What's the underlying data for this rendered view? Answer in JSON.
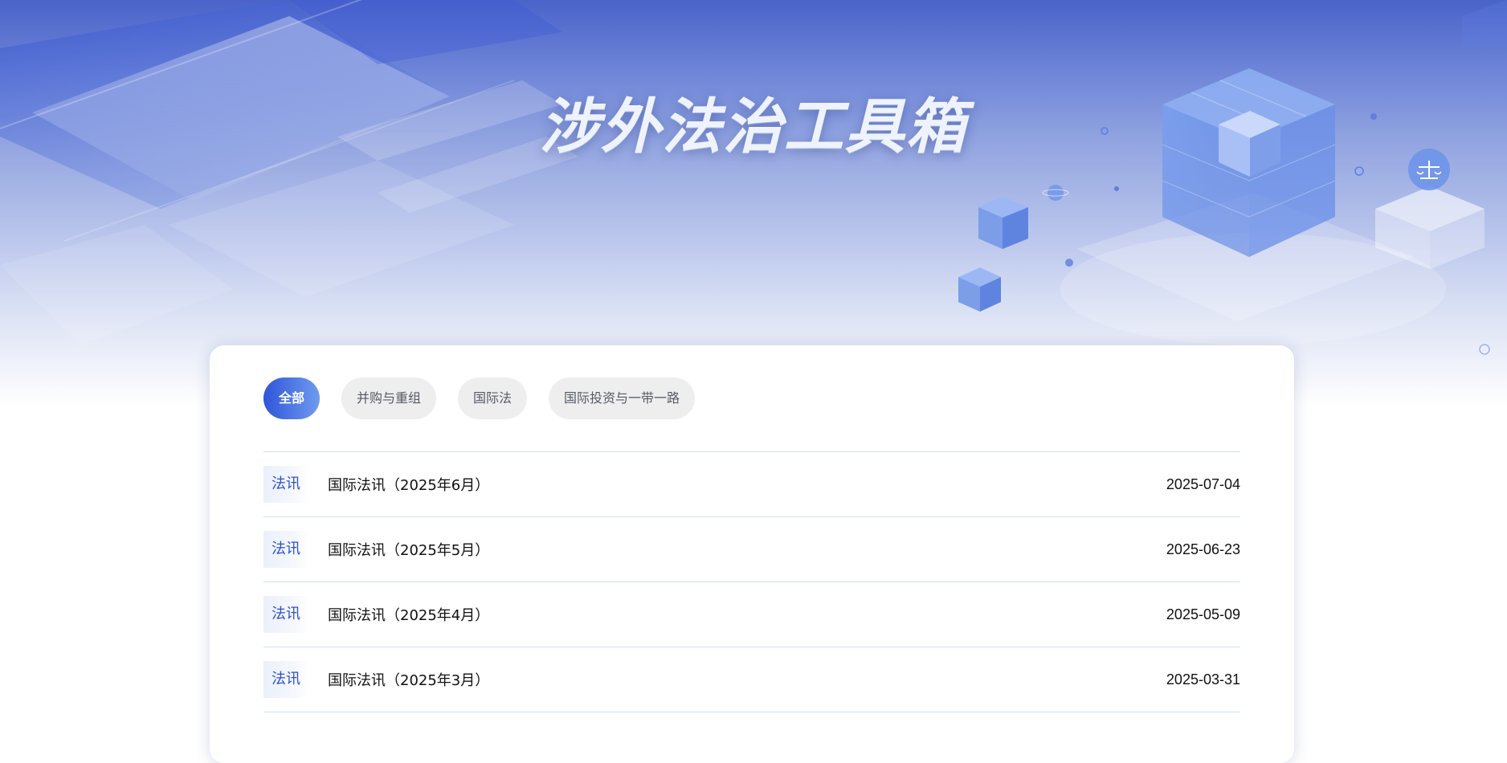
{
  "hero": {
    "title": "涉外法治工具箱"
  },
  "filters": [
    {
      "label": "全部",
      "active": true
    },
    {
      "label": "并购与重组",
      "active": false
    },
    {
      "label": "国际法",
      "active": false
    },
    {
      "label": "国际投资与一带一路",
      "active": false
    }
  ],
  "articles": [
    {
      "tag": "法讯",
      "title": "国际法讯（2025年6月）",
      "date": "2025-07-04"
    },
    {
      "tag": "法讯",
      "title": "国际法讯（2025年5月）",
      "date": "2025-06-23"
    },
    {
      "tag": "法讯",
      "title": "国际法讯（2025年4月）",
      "date": "2025-05-09"
    },
    {
      "tag": "法讯",
      "title": "国际法讯（2025年3月）",
      "date": "2025-03-31"
    }
  ],
  "colors": {
    "accent": "#2f55d8",
    "tag_text": "#2d4fd0",
    "divider": "#cfe3f3"
  },
  "icons": [
    "scales-icon",
    "cube-illustration"
  ]
}
